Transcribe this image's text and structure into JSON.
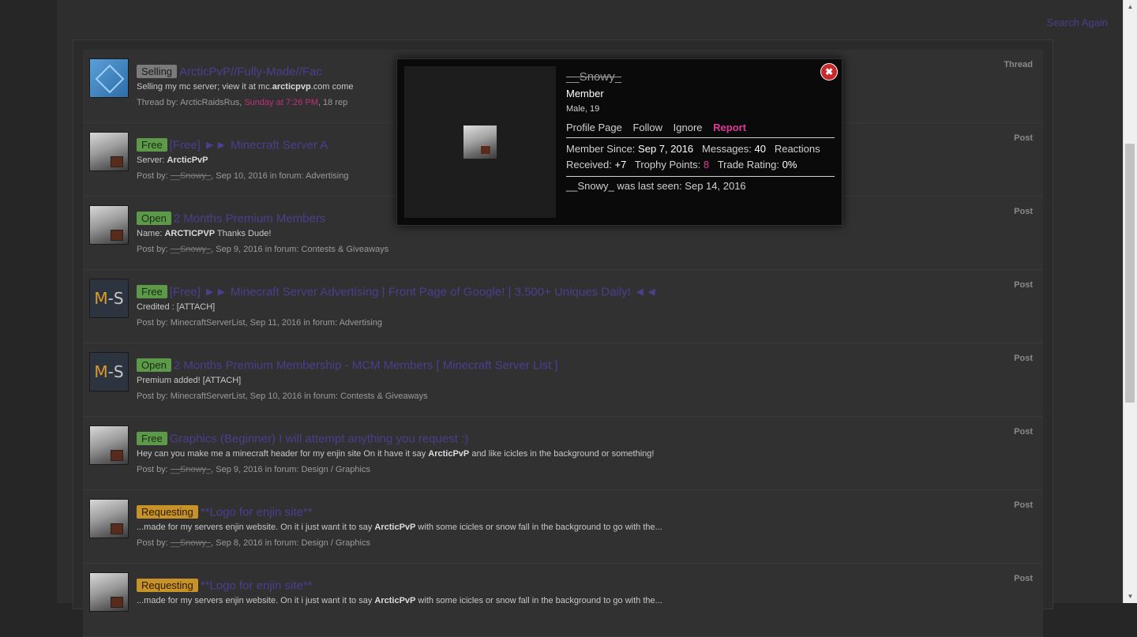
{
  "header": {
    "title_fragment": "",
    "search_again": "Search Again"
  },
  "results": [
    {
      "prefix": "Selling",
      "prefix_style": "selling",
      "avatar": "cube",
      "title": "ArcticPvP//Fully-Made//Fac",
      "snippet_pre": "Selling my mc server; view it at mc.",
      "snippet_bold": "arcticpvp",
      "snippet_post": ".com come",
      "meta_pre": "Thread by: ArcticRaidsRus, ",
      "meta_hot": "Sunday at 7:26 PM",
      "meta_post": ", 18 rep",
      "type": "Thread"
    },
    {
      "prefix": "Free",
      "prefix_style": "free",
      "avatar": "snowy",
      "title": "[Free] ►► Minecraft Server A",
      "snippet_pre": "Server: ",
      "snippet_bold": "ArcticPvP",
      "snippet_post": "",
      "meta_pre": "Post by: ",
      "meta_strike": "__Snowy_",
      "meta_post": ", Sep 10, 2016 in forum: Advertising",
      "type": "Post"
    },
    {
      "prefix": "Open",
      "prefix_style": "open",
      "avatar": "snowy",
      "title": "2 Months Premium Members",
      "snippet_pre": "Name: ",
      "snippet_bold": "ARCTICPVP",
      "snippet_post": " Thanks Dude!",
      "meta_pre": "Post by: ",
      "meta_strike": "__Snowy_",
      "meta_post": ", Sep 9, 2016 in forum: Contests & Giveaways",
      "type": "Post"
    },
    {
      "prefix": "Free",
      "prefix_style": "free",
      "avatar": "ms",
      "title": "[Free] ►► Minecraft Server Advertising | Front Page of Google! | 3,500+ Uniques Daily! ◄◄",
      "snippet_pre": "Credited : [ATTACH]",
      "snippet_bold": "",
      "snippet_post": "",
      "meta_pre": "Post by: MinecraftServerList, Sep 11, 2016 in forum: Advertising",
      "meta_strike": "",
      "meta_post": "",
      "type": "Post"
    },
    {
      "prefix": "Open",
      "prefix_style": "open",
      "avatar": "ms",
      "title": "2 Months Premium Membership - MCM Members [ Minecraft Server List ]",
      "snippet_pre": "Premium added! [ATTACH]",
      "snippet_bold": "",
      "snippet_post": "",
      "meta_pre": "Post by: MinecraftServerList, Sep 10, 2016 in forum: Contests & Giveaways",
      "meta_strike": "",
      "meta_post": "",
      "type": "Post"
    },
    {
      "prefix": "Free",
      "prefix_style": "free",
      "avatar": "snowy",
      "title": "Graphics (Beginner) I will attempt anything you request :)",
      "snippet_pre": "Hey can you make me a minecraft header for my enjin site On it have it say ",
      "snippet_bold": "ArcticPvP",
      "snippet_post": " and like icicles in the background or something!",
      "meta_pre": "Post by: ",
      "meta_strike": "__Snowy_",
      "meta_post": ", Sep 9, 2016 in forum: Design / Graphics",
      "type": "Post"
    },
    {
      "prefix": "Requesting",
      "prefix_style": "requesting",
      "avatar": "snowy",
      "title": "**Logo for enjin site**",
      "snippet_pre": "...made for my servers enjin website. On it i just want it to say ",
      "snippet_bold": "ArcticPvP",
      "snippet_post": " with some icicles or snow fall in the background to go with the...",
      "meta_pre": "Post by: ",
      "meta_strike": "__Snowy_",
      "meta_post": ", Sep 8, 2016 in forum: Design / Graphics",
      "type": "Post"
    },
    {
      "prefix": "Requesting",
      "prefix_style": "requesting",
      "avatar": "snowy",
      "title": "**Logo for enjin site**",
      "snippet_pre": "...made for my servers enjin website. On it i just want it to say ",
      "snippet_bold": "ArcticPvP",
      "snippet_post": " with some icicles or snow fall in the background to go with the...",
      "meta_pre": "",
      "meta_strike": "",
      "meta_post": "",
      "type": "Post"
    }
  ],
  "popup": {
    "username": "__Snowy_",
    "role": "Member",
    "info": "Male, 19",
    "links": [
      "Profile Page",
      "Follow",
      "Ignore",
      "Report"
    ],
    "member_since_label": "Member Since:",
    "member_since": "Sep 7, 2016",
    "messages_label": "Messages:",
    "messages": "40",
    "reactions_label": "Reactions Received:",
    "reactions": "+7",
    "trophy_label": "Trophy Points:",
    "trophy": "8",
    "trade_label": "Trade Rating:",
    "trade": "0%",
    "last_seen": "__Snowy_ was last seen: Sep 14, 2016",
    "close_icon": "close-icon"
  },
  "colors": {
    "link": "#4b3f8f",
    "accent": "#e0369a",
    "background": "#2e2e2e"
  }
}
